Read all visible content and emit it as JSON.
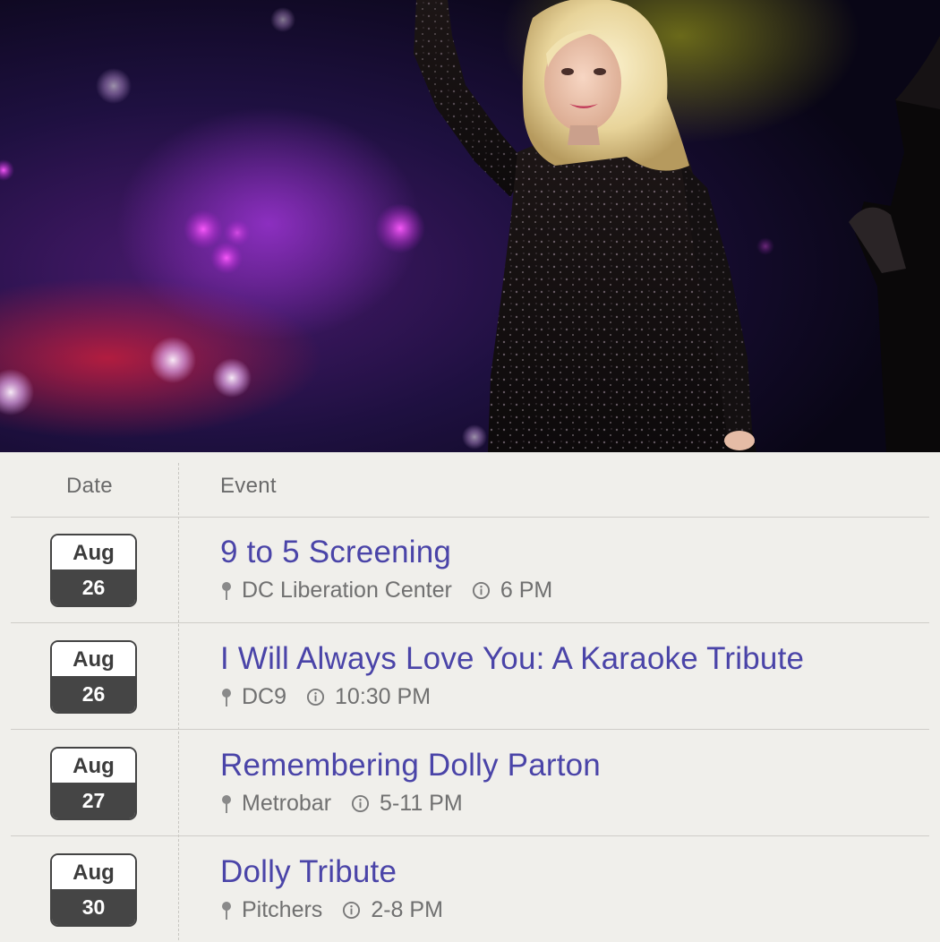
{
  "table": {
    "header": {
      "date": "Date",
      "event": "Event"
    }
  },
  "events": [
    {
      "month": "Aug",
      "day": "26",
      "title": "9 to 5 Screening",
      "venue": "DC Liberation Center",
      "time": "6 PM"
    },
    {
      "month": "Aug",
      "day": "26",
      "title": "I Will Always Love You: A Karaoke Tribute",
      "venue": "DC9",
      "time": "10:30 PM"
    },
    {
      "month": "Aug",
      "day": "27",
      "title": "Remembering Dolly Parton",
      "venue": "Metrobar",
      "time": "5-11 PM"
    },
    {
      "month": "Aug",
      "day": "30",
      "title": "Dolly Tribute",
      "venue": "Pitchers",
      "time": "2-8 PM"
    }
  ],
  "icons": {
    "location": "location-pin-icon",
    "time": "clock-info-icon"
  },
  "colors": {
    "title": "#4a44a8",
    "meta": "#707070",
    "background": "#f0efeb",
    "calendar_day_bg": "#454545"
  }
}
